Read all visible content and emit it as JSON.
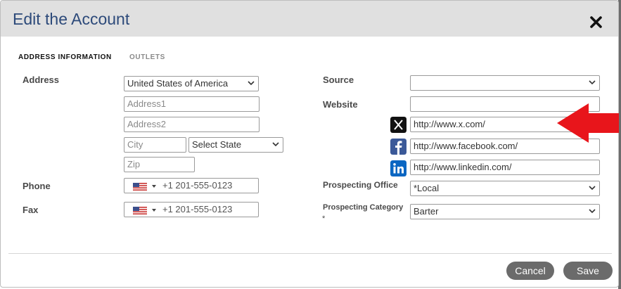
{
  "dialog": {
    "title": "Edit the Account",
    "close_icon": "close-icon"
  },
  "tabs": [
    {
      "label": "ADDRESS INFORMATION",
      "active": true
    },
    {
      "label": "OUTLETS",
      "active": false
    }
  ],
  "address": {
    "label": "Address",
    "country_value": "United States of America",
    "address1_placeholder": "Address1",
    "address2_placeholder": "Address2",
    "city_placeholder": "City",
    "state_value": "Select State",
    "zip_placeholder": "Zip"
  },
  "phone": {
    "label": "Phone",
    "country_flag": "us-flag-icon",
    "placeholder": "+1 201-555-0123"
  },
  "fax": {
    "label": "Fax",
    "country_flag": "us-flag-icon",
    "placeholder": "+1 201-555-0123"
  },
  "source": {
    "label": "Source",
    "value": ""
  },
  "website": {
    "label": "Website",
    "value": ""
  },
  "social": [
    {
      "icon": "x-icon",
      "color": "#111111",
      "value": "http://www.x.com/"
    },
    {
      "icon": "facebook-icon",
      "color": "#3b5998",
      "value": "http://www.facebook.com/"
    },
    {
      "icon": "linkedin-icon",
      "color": "#0a66c2",
      "value": "http://www.linkedin.com/"
    }
  ],
  "prospecting_office": {
    "label": "Prospecting Office",
    "value": "*Local"
  },
  "prospecting_category": {
    "label": "Prospecting Category",
    "required_mark": "*",
    "value": "Barter"
  },
  "buttons": {
    "cancel": "Cancel",
    "save": "Save"
  },
  "colors": {
    "title": "#2d4a7a",
    "button": "#6b6b6b",
    "annotation_arrow": "#e8151b"
  }
}
